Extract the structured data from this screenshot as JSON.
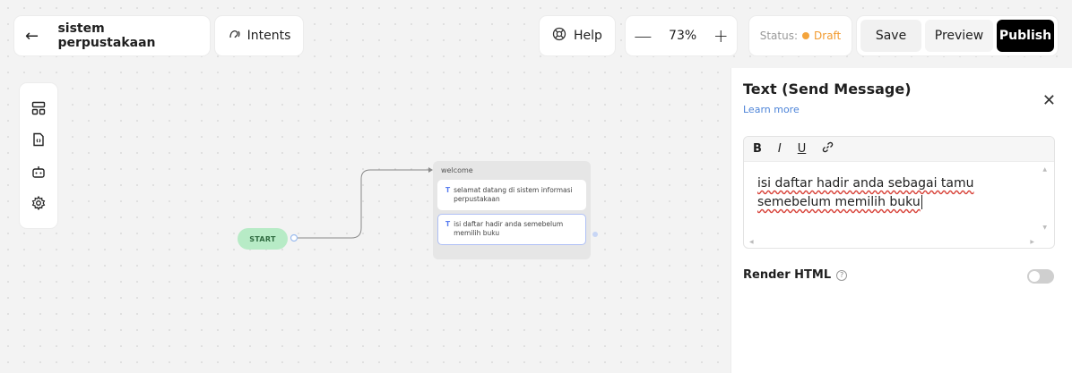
{
  "header": {
    "back_icon": "arrow-left-icon",
    "project_name": "sistem perpustakaan",
    "intents_label": "Intents",
    "help_label": "Help",
    "zoom": {
      "minus": "—",
      "value": "73%",
      "plus": "+"
    },
    "status": {
      "label": "Status:",
      "value": "Draft",
      "color": "#f4a43c"
    },
    "save_label": "Save",
    "preview_label": "Preview",
    "publish_label": "Publish"
  },
  "sidebar_tools": [
    "layout-icon",
    "variables-icon",
    "bot-icon",
    "settings-icon"
  ],
  "canvas": {
    "start_label": "START",
    "block": {
      "title": "welcome",
      "steps": [
        {
          "icon": "T",
          "text": "selamat datang di sistem informasi perpustakaan"
        },
        {
          "icon": "T",
          "text": "isi daftar hadir anda semebelum memilih buku"
        }
      ]
    }
  },
  "panel": {
    "title": "Text (Send Message)",
    "learn_more": "Learn more",
    "toolbar": {
      "bold": "B",
      "italic": "I",
      "underline": "U",
      "link_icon": "link-icon"
    },
    "editor_text": "isi daftar hadir anda sebagai tamu semebelum memilih buku",
    "render_html_label": "Render HTML",
    "render_html_enabled": false
  }
}
